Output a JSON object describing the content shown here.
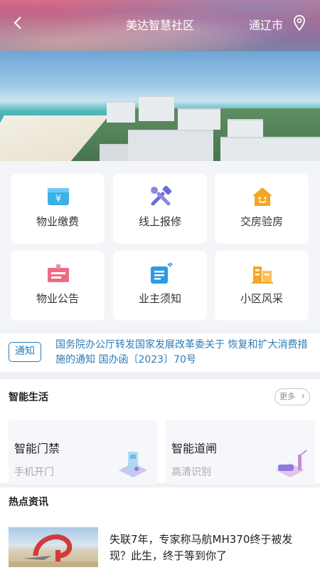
{
  "header": {
    "title": "美达智慧社区",
    "city": "通辽市"
  },
  "services": [
    {
      "label": "物业缴费",
      "icon": "yuan-wallet-icon"
    },
    {
      "label": "线上报修",
      "icon": "wrench-hammer-icon"
    },
    {
      "label": "交房验房",
      "icon": "house-smile-icon"
    },
    {
      "label": "物业公告",
      "icon": "notice-board-icon"
    },
    {
      "label": "业主须知",
      "icon": "document-icon"
    },
    {
      "label": "小区风采",
      "icon": "buildings-icon"
    }
  ],
  "notice": {
    "tag": "通知",
    "text": "国务院办公厅转发国家发展改革委关于 恢复和扩大消费措施的通知 国办函〔2023〕70号"
  },
  "smart_life": {
    "title": "智能生活",
    "more": "更多",
    "cards": [
      {
        "title": "智能门禁",
        "subtitle": "手机开门"
      },
      {
        "title": "智能道闸",
        "subtitle": "高清识别"
      }
    ]
  },
  "news": {
    "title": "热点资讯",
    "items": [
      {
        "headline": "失联7年，专家称马航MH370终于被发现？此生，终于等到你了"
      }
    ]
  },
  "colors": {
    "accent": "#2c7cb8"
  }
}
